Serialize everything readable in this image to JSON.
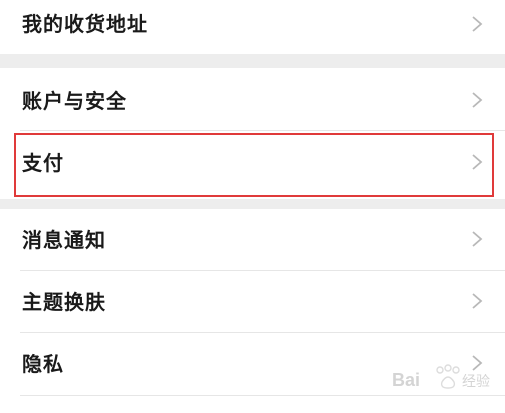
{
  "settings": {
    "items": [
      {
        "label": "我的收货地址"
      },
      {
        "label": "账户与安全"
      },
      {
        "label": "支付"
      },
      {
        "label": "消息通知"
      },
      {
        "label": "主题换肤"
      },
      {
        "label": "隐私"
      }
    ],
    "highlighted_item": "支付",
    "chevron_icon": "chevron-right-icon"
  },
  "watermark": {
    "brand_text": "Baidu经验"
  },
  "colors": {
    "background": "#ffffff",
    "section_gap": "#ededed",
    "text": "#1a1a1a",
    "chevron": "#b8b8b8",
    "highlight": "#e03a3a"
  }
}
